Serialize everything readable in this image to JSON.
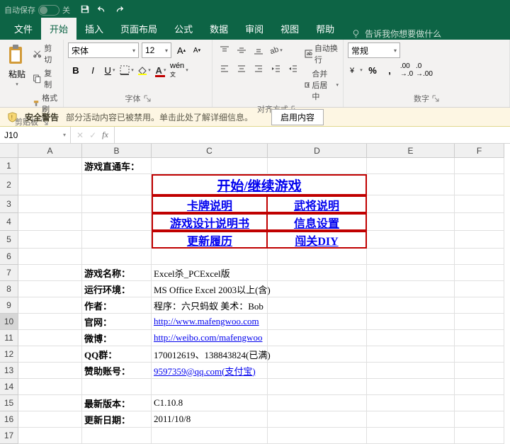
{
  "titlebar": {
    "autosave_label": "自动保存",
    "autosave_state": "关"
  },
  "tabs": {
    "file": "文件",
    "home": "开始",
    "insert": "插入",
    "layout": "页面布局",
    "formulas": "公式",
    "data": "数据",
    "review": "审阅",
    "view": "视图",
    "help": "帮助",
    "tellme": "告诉我你想要做什么"
  },
  "ribbon": {
    "clipboard": {
      "label": "剪贴板",
      "paste": "粘贴",
      "cut": "剪切",
      "copy": "复制",
      "format_painter": "格式刷"
    },
    "font": {
      "label": "字体",
      "name": "宋体",
      "size": "12"
    },
    "align": {
      "label": "对齐方式",
      "wrap": "自动换行",
      "merge": "合并后居中"
    },
    "number": {
      "label": "数字",
      "format": "常规"
    }
  },
  "warn": {
    "title": "安全警告",
    "msg": "部分活动内容已被禁用。单击此处了解详细信息。",
    "enable": "启用内容"
  },
  "namebox": "J10",
  "cols": [
    "A",
    "B",
    "C",
    "D",
    "E",
    "F"
  ],
  "rows": [
    "1",
    "2",
    "3",
    "4",
    "5",
    "6",
    "7",
    "8",
    "9",
    "10",
    "11",
    "12",
    "13",
    "14",
    "15",
    "16",
    "17"
  ],
  "cells": {
    "B1": "游戏直通车：",
    "CD2": "开始/继续游戏",
    "C3": "卡牌说明",
    "D3": "武将说明",
    "C4": "游戏设计说明书",
    "D4": "信息设置",
    "C5": "更新履历",
    "D5": "闯关DIY",
    "B7": "游戏名称：",
    "C7": "Excel杀_PCExcel版",
    "B8": "运行环境：",
    "C8": "MS Office Excel 2003以上(含)",
    "B9": "作者：",
    "C9": "程序：六只蚂蚁    美术：Bob",
    "B10": "官网：",
    "C10": "http://www.mafengwoo.com",
    "B11": "微博：",
    "C11": "http://weibo.com/mafengwoo",
    "B12": "QQ群：",
    "C12": "170012619、138843824(已满)",
    "B13": "赞助账号：",
    "C13": "9597359@qq.com(支付宝)",
    "B15": "最新版本：",
    "C15": "C1.10.8",
    "B16": "更新日期：",
    "C16": "2011/10/8"
  }
}
